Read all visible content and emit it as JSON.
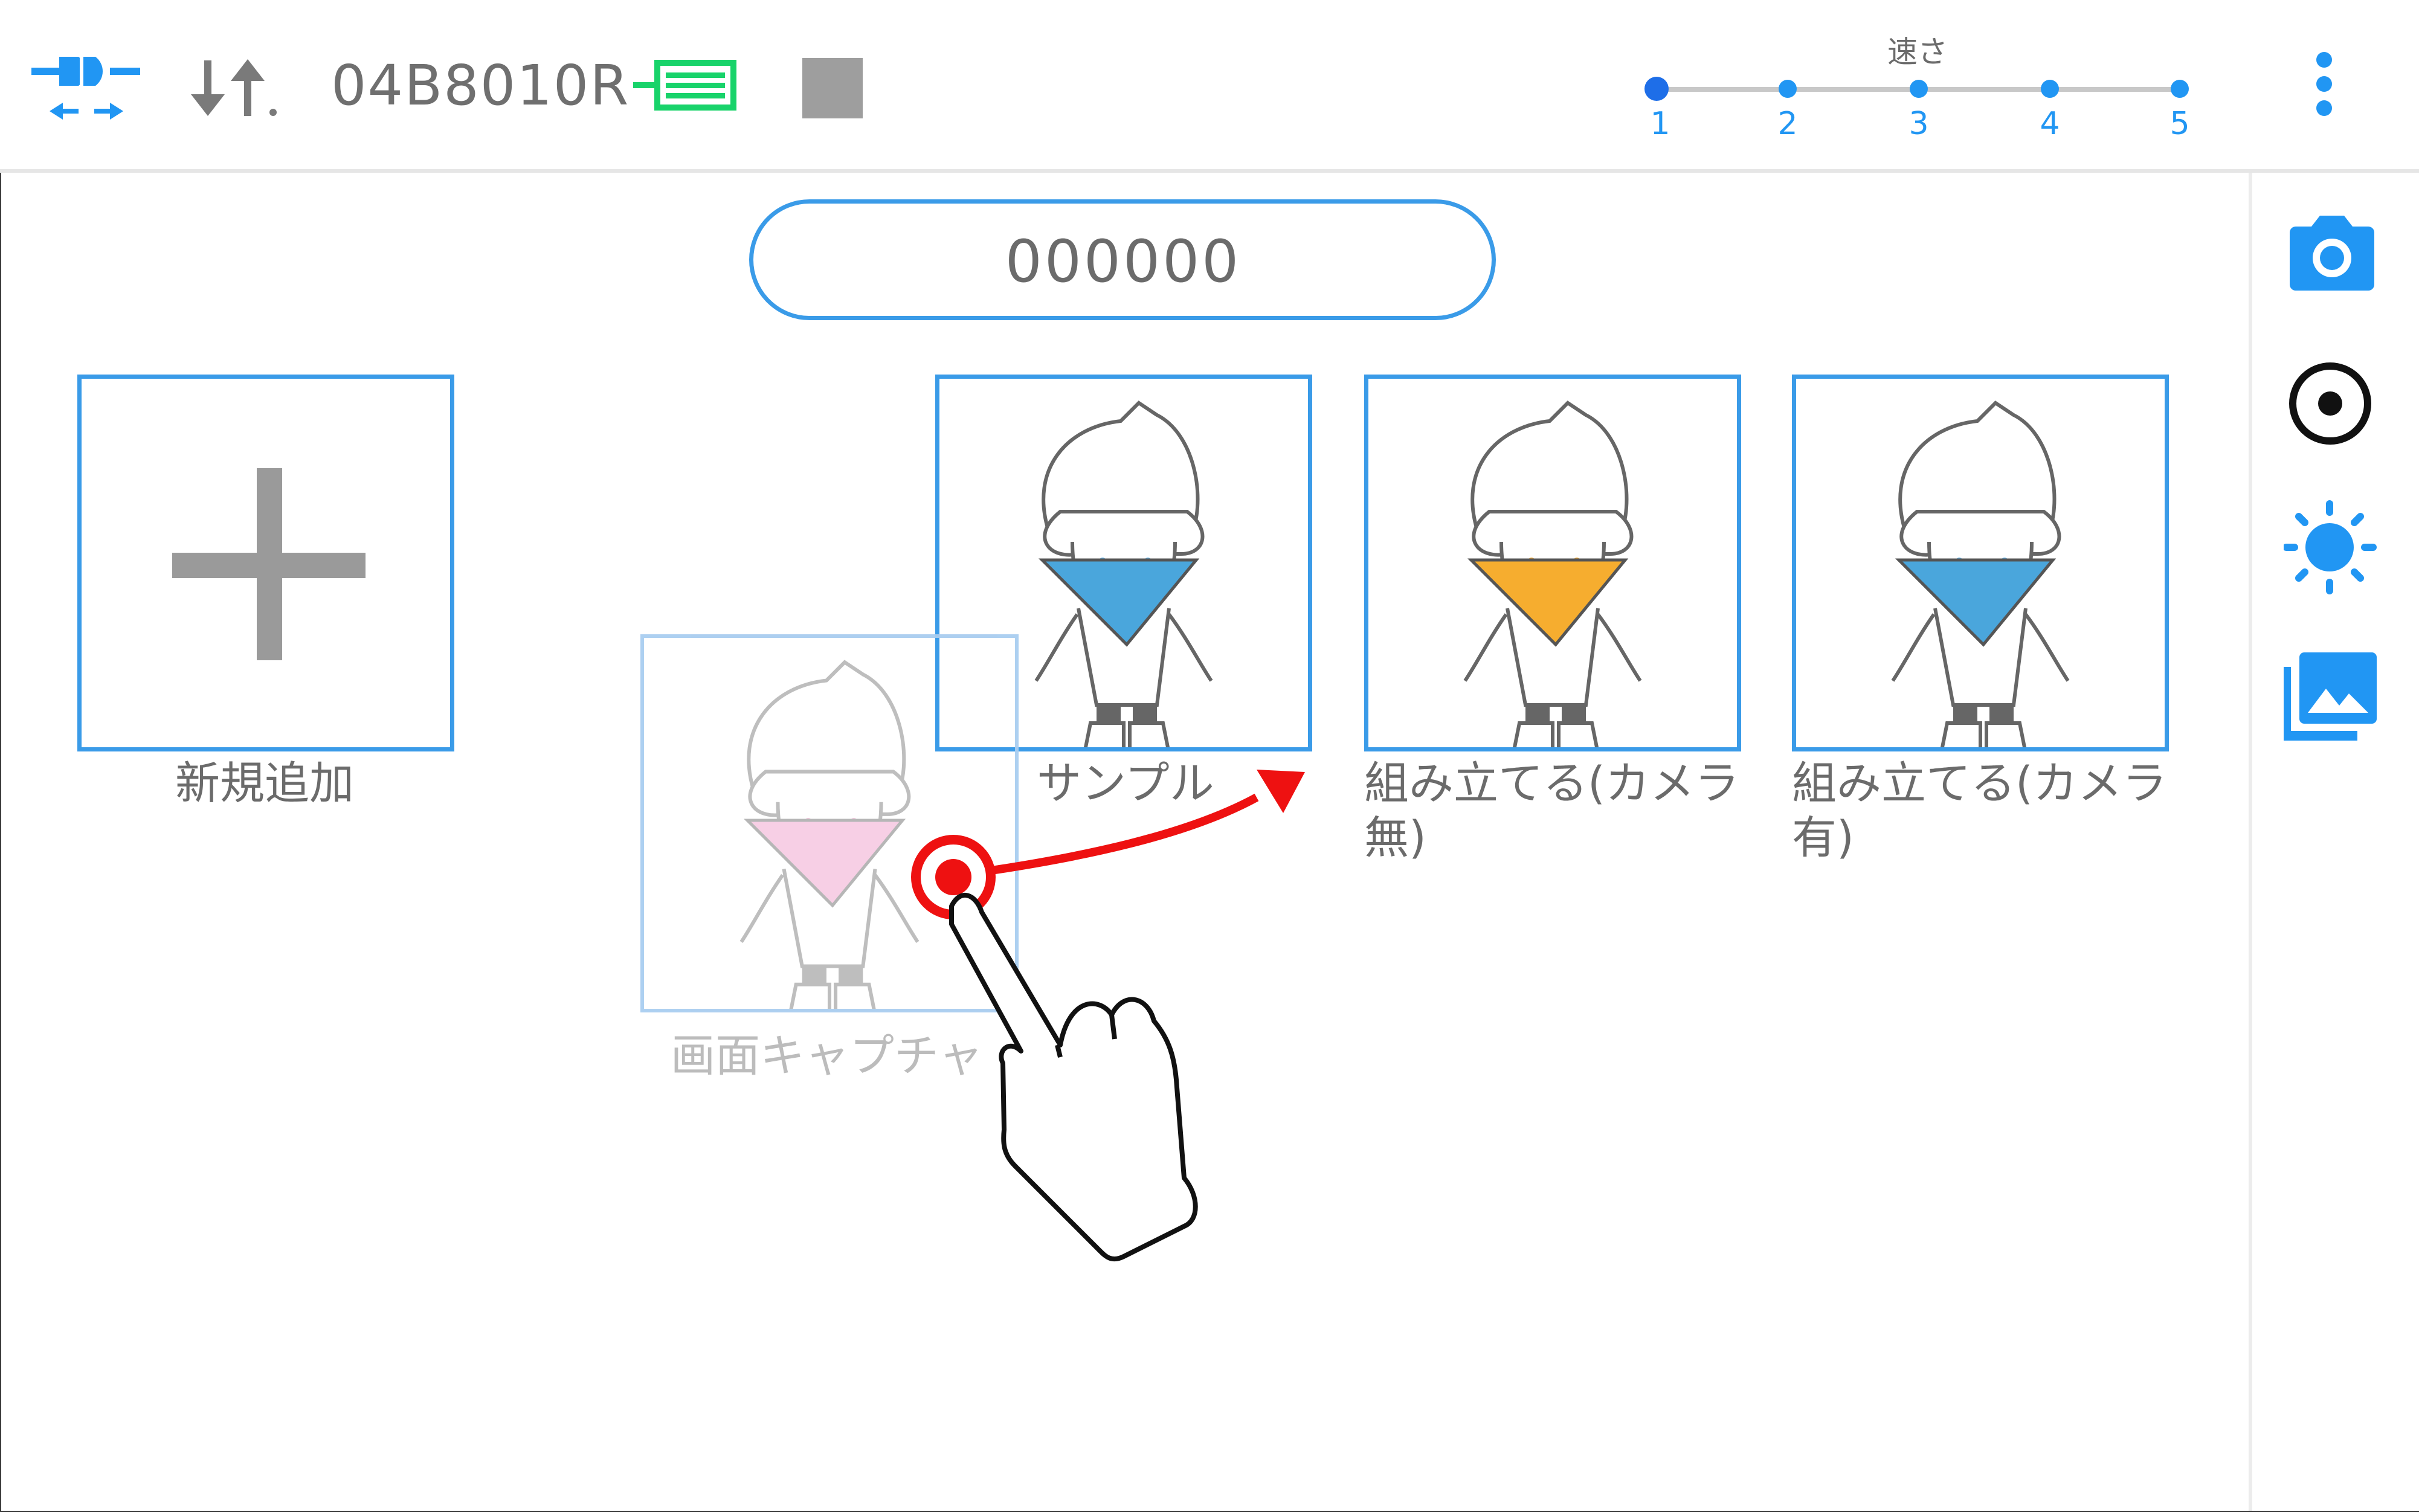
{
  "header": {
    "device_id": "04B8010R",
    "connect_icon": "plug-connect-icon",
    "transfer_icon": "sort-transfer-icon",
    "battery_icon": "battery-icon",
    "stop_icon": "stop-square-icon",
    "speed": {
      "title": "速さ",
      "levels": [
        "1",
        "2",
        "3",
        "4",
        "5"
      ],
      "selected": "1"
    },
    "menu_icon": "kebab-menu-icon"
  },
  "search": {
    "value": "000000"
  },
  "cards": [
    {
      "label": "新規追加",
      "icon": "plus-icon"
    },
    {
      "label": "サンプル",
      "icon": "robot-character-blue"
    },
    {
      "label_line1": "組み立てる(カメラ",
      "label_line2": "無)",
      "icon": "robot-character-orange"
    },
    {
      "label_line1": "組み立てる(カメラ",
      "label_line2": "有)",
      "icon": "robot-character-blue"
    }
  ],
  "dragging_card": {
    "label": "画面キャプチャ",
    "icon": "robot-character-pink"
  },
  "gesture": {
    "icon": "drag-hand-pointer-icon",
    "arrow": "drag-direction-arrow"
  },
  "side_panel": {
    "items": [
      "camera-icon",
      "record-icon",
      "brightness-icon",
      "gallery-icon"
    ]
  },
  "colors": {
    "accent": "#2196f3",
    "battery": "#18d36a",
    "gesture": "#ee1111"
  }
}
